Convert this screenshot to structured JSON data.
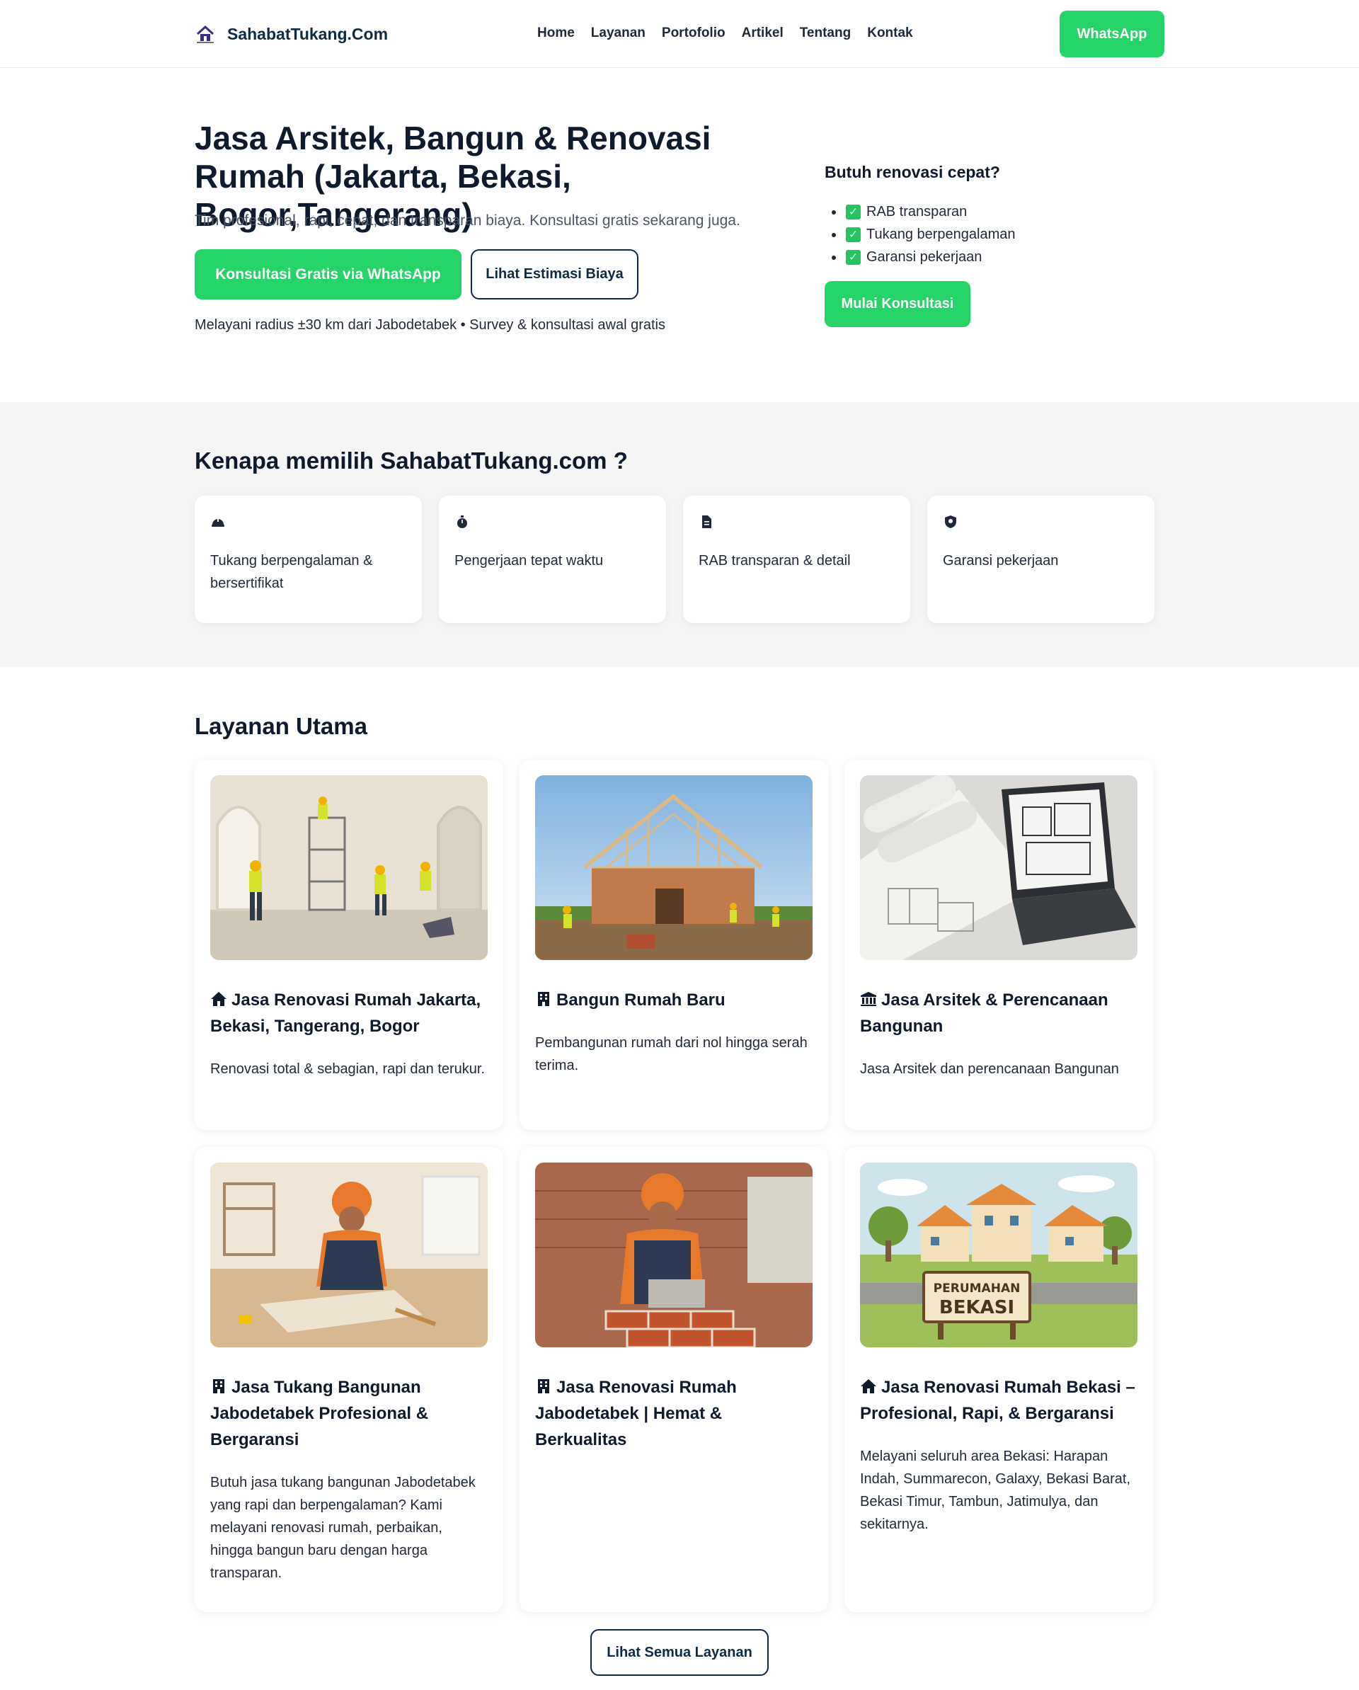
{
  "nav": {
    "brand": "SahabatTukang.Com",
    "menu": [
      "Home",
      "Layanan",
      "Portofolio",
      "Artikel",
      "Tentang",
      "Kontak"
    ],
    "cta": "WhatsApp"
  },
  "hero": {
    "title": "Jasa Arsitek, Bangun & Renovasi Rumah (Jakarta, Bekasi, Bogor,Tangerang)",
    "lead": "Tim profesional, rapi, cepat, dan transparan biaya. Konsultasi gratis sekarang juga.",
    "primary_button": "Konsultasi Gratis via WhatsApp",
    "secondary_button": "Lihat Estimasi Biaya",
    "note": "Melayani radius ±30 km dari Jabodetabek • Survey & konsultasi awal gratis",
    "aside": {
      "title": "Butuh renovasi cepat?",
      "items": [
        "RAB transparan",
        "Tukang berpengalaman",
        "Garansi pekerjaan"
      ],
      "button": "Mulai Konsultasi"
    }
  },
  "why": {
    "title": "Kenapa memilih SahabatTukang.com ?",
    "features": [
      {
        "icon": "helmet-icon",
        "text": "Tukang berpengalaman & bersertifikat"
      },
      {
        "icon": "stopwatch-icon",
        "text": "Pengerjaan tepat waktu"
      },
      {
        "icon": "document-icon",
        "text": "RAB transparan & detail"
      },
      {
        "icon": "shield-icon",
        "text": "Garansi pekerjaan"
      }
    ]
  },
  "services": {
    "title": "Layanan Utama",
    "cards": [
      {
        "icon": "house-icon",
        "title": "Jasa Renovasi Rumah Jakarta, Bekasi, Tangerang, Bogor",
        "desc": "Renovasi total & sebagian, rapi dan terukur."
      },
      {
        "icon": "building-icon",
        "title": "Bangun Rumah Baru",
        "desc": "Pembangunan rumah dari nol hingga serah terima."
      },
      {
        "icon": "landmark-icon",
        "title": "Jasa Arsitek & Perencanaan Bangunan",
        "desc": "Jasa Arsitek dan perencanaan Bangunan"
      },
      {
        "icon": "building-icon",
        "title": "Jasa Tukang Bangunan Jabodetabek Profesional & Bergaransi",
        "desc": "Butuh jasa tukang bangunan Jabodetabek yang rapi dan berpengalaman? Kami melayani renovasi rumah, perbaikan, hingga bangun baru dengan harga transparan."
      },
      {
        "icon": "building-icon",
        "title": "Jasa Renovasi Rumah Jabodetabek | Hemat & Berkualitas",
        "desc": ""
      },
      {
        "icon": "house-icon",
        "title": "Jasa Renovasi Rumah Bekasi – Profesional, Rapi, & Bergaransi",
        "desc": "Melayani seluruh area Bekasi: Harapan Indah, Summarecon, Galaxy, Bekasi Barat, Bekasi Timur, Tambun, Jatimulya, dan sekitarnya."
      }
    ],
    "sign_text": [
      "PERUMAHAN",
      "BEKASI"
    ],
    "more_button": "Lihat Semua Layanan"
  },
  "colors": {
    "accent_green": "#25d366",
    "navy": "#0f2a44",
    "section_bg": "#f5f5f5"
  }
}
